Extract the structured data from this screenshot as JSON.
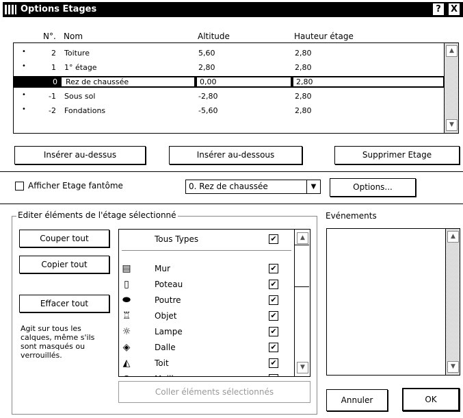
{
  "window": {
    "title": "Options Etages",
    "help_label": "?",
    "close_label": "X"
  },
  "columns": {
    "num": "N°.",
    "name": "Nom",
    "altitude": "Altitude",
    "height": "Hauteur étage"
  },
  "stories": [
    {
      "bullet": "•",
      "num": "2",
      "name": "Toiture",
      "altitude": "5,60",
      "height": "2,80",
      "selected": false
    },
    {
      "bullet": "•",
      "num": "1",
      "name": "1° étage",
      "altitude": "2,80",
      "height": "2,80",
      "selected": false
    },
    {
      "bullet": "",
      "num": "0",
      "name": "Rez de chaussée",
      "altitude": "0,00",
      "height": "2,80",
      "selected": true
    },
    {
      "bullet": "•",
      "num": "-1",
      "name": "Sous sol",
      "altitude": "-2,80",
      "height": "2,80",
      "selected": false
    },
    {
      "bullet": "•",
      "num": "-2",
      "name": "Fondations",
      "altitude": "-5,60",
      "height": "2,80",
      "selected": false
    }
  ],
  "buttons": {
    "insert_above": "Insérer au-dessus",
    "insert_below": "Insérer au-dessous",
    "delete_story": "Supprimer Etage",
    "options": "Options...",
    "cut_all": "Couper tout",
    "copy_all": "Copier tout",
    "clear_all": "Effacer tout",
    "paste_selected": "Coller éléments sélectionnés",
    "cancel": "Annuler",
    "ok": "OK"
  },
  "ghost_story": {
    "label": "Afficher Etage fantôme",
    "checked": false,
    "selected_value": "0. Rez de chaussée"
  },
  "edit_group": {
    "label": "Editer éléments de l'étage sélectionné",
    "note": "Agit sur tous les calques, même s'ils sont masqués ou verrouillés.",
    "all_types_label": "Tous Types",
    "types": [
      {
        "name": "Mur",
        "icon": "wall-icon",
        "checked": true
      },
      {
        "name": "Poteau",
        "icon": "column-icon",
        "checked": true
      },
      {
        "name": "Poutre",
        "icon": "beam-icon",
        "checked": true
      },
      {
        "name": "Objet",
        "icon": "object-icon",
        "checked": true
      },
      {
        "name": "Lampe",
        "icon": "lamp-icon",
        "checked": true
      },
      {
        "name": "Dalle",
        "icon": "slab-icon",
        "checked": true
      },
      {
        "name": "Toit",
        "icon": "roof-icon",
        "checked": true
      },
      {
        "name": "Maill...",
        "icon": "mesh-icon",
        "checked": true
      }
    ],
    "check_glyph": "✔"
  },
  "events": {
    "label": "Evénements"
  },
  "icons": {
    "scroll_up": "▲",
    "scroll_down": "▼",
    "dropdown": "▼"
  }
}
